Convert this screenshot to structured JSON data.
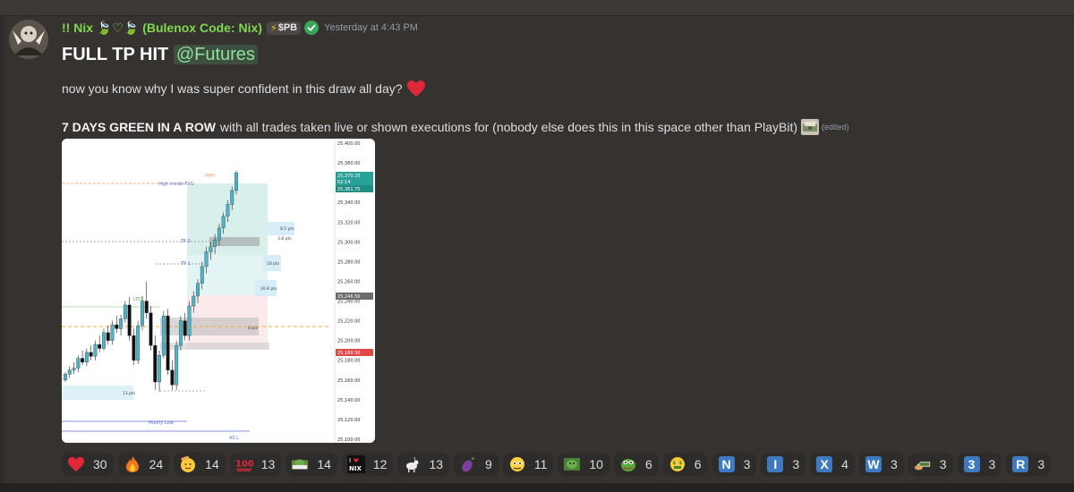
{
  "message": {
    "username": "!! Nix 🍃♡🍃 (Bulenox Code: Nix)",
    "tag": "$PB",
    "timestamp": "Yesterday at 4:43 PM",
    "title": "FULL TP HIT",
    "mention": "@Futures",
    "line2": "now you know why I was super confident in this draw all day?",
    "line3_bold": "7 DAYS GREEN IN A ROW",
    "line3_rest": "with all trades taken live or shown executions for (nobody else does this in this space other than PlayBit)",
    "edited": "(edited)"
  },
  "chart_labels": {
    "pmh": "PMH",
    "high_inside_fvg": "High Inside FVG",
    "tp2": "TP 2",
    "tp1": "TP 1",
    "ltcs": "LTCS",
    "hourly_low": "Hourly Low",
    "asl": "AS.L",
    "pts_8_5": "8.5 pts",
    "pts_3_8": "3.8 pts",
    "pts_18": "18 pts",
    "pts_16_8": "16.8 pts",
    "pts_8": "8 pts",
    "pts_13": "13 pts",
    "price_badge_1": "25,370.25",
    "price_badge_2": "02:14",
    "price_badge_3": "25,361.75",
    "price_badge_4": "25,246.50",
    "price_badge_5": "25,189.50"
  },
  "chart_data": {
    "type": "candlestick",
    "y_ticks": [
      "25,400.00",
      "25,380.00",
      "25,360.00",
      "25,340.00",
      "25,320.00",
      "25,300.00",
      "25,280.00",
      "25,260.00",
      "25,240.00",
      "25,220.00",
      "25,200.00",
      "25,180.00",
      "25,160.00",
      "25,140.00",
      "25,120.00",
      "25,100.00"
    ],
    "ylim": [
      25100,
      25400
    ],
    "candles": [
      [
        25160,
        25168,
        25158,
        25166
      ],
      [
        25166,
        25174,
        25162,
        25170
      ],
      [
        25170,
        25178,
        25166,
        25172
      ],
      [
        25172,
        25185,
        25168,
        25182
      ],
      [
        25182,
        25190,
        25175,
        25178
      ],
      [
        25178,
        25192,
        25174,
        25188
      ],
      [
        25188,
        25195,
        25180,
        25184
      ],
      [
        25184,
        25200,
        25180,
        25196
      ],
      [
        25196,
        25205,
        25188,
        25192
      ],
      [
        25192,
        25212,
        25190,
        25208
      ],
      [
        25208,
        25215,
        25196,
        25200
      ],
      [
        25200,
        25220,
        25196,
        25216
      ],
      [
        25216,
        25225,
        25208,
        25212
      ],
      [
        25212,
        25226,
        25205,
        25222
      ],
      [
        25222,
        25240,
        25218,
        25236
      ],
      [
        25236,
        25244,
        25200,
        25205
      ],
      [
        25205,
        25212,
        25175,
        25180
      ],
      [
        25180,
        25220,
        25176,
        25215
      ],
      [
        25215,
        25245,
        25210,
        25240
      ],
      [
        25240,
        25260,
        25222,
        25228
      ],
      [
        25228,
        25235,
        25190,
        25195
      ],
      [
        25195,
        25205,
        25150,
        25158
      ],
      [
        25158,
        25190,
        25148,
        25185
      ],
      [
        25185,
        25230,
        25182,
        25225
      ],
      [
        25225,
        25232,
        25165,
        25170
      ],
      [
        25170,
        25180,
        25150,
        25155
      ],
      [
        25155,
        25200,
        25150,
        25195
      ],
      [
        25195,
        25225,
        25190,
        25220
      ],
      [
        25220,
        25228,
        25200,
        25205
      ],
      [
        25205,
        25240,
        25200,
        25235
      ],
      [
        25235,
        25250,
        25228,
        25245
      ],
      [
        25245,
        25262,
        25238,
        25258
      ],
      [
        25258,
        25280,
        25252,
        25275
      ],
      [
        25275,
        25295,
        25268,
        25290
      ],
      [
        25290,
        25300,
        25282,
        25295
      ],
      [
        25295,
        25308,
        25288,
        25302
      ],
      [
        25302,
        25318,
        25296,
        25314
      ],
      [
        25314,
        25330,
        25308,
        25326
      ],
      [
        25326,
        25342,
        25320,
        25338
      ],
      [
        25338,
        25356,
        25332,
        25352
      ],
      [
        25352,
        25372,
        25348,
        25370
      ]
    ]
  },
  "reactions": [
    {
      "emoji": "heart",
      "count": "30"
    },
    {
      "emoji": "fire",
      "count": "24"
    },
    {
      "emoji": "saluting-face",
      "count": "14"
    },
    {
      "emoji": "hundred",
      "count": "13"
    },
    {
      "emoji": "money-pepe",
      "count": "14"
    },
    {
      "emoji": "i-heart-nix",
      "count": "12"
    },
    {
      "emoji": "goat",
      "count": "13"
    },
    {
      "emoji": "eggplant",
      "count": "9"
    },
    {
      "emoji": "pepe-face",
      "count": "11"
    },
    {
      "emoji": "pepe-money",
      "count": "10"
    },
    {
      "emoji": "pepe-green",
      "count": "6"
    },
    {
      "emoji": "money-mouth",
      "count": "6"
    },
    {
      "letter": "N",
      "count": "3"
    },
    {
      "letter": "I",
      "count": "3"
    },
    {
      "letter": "X",
      "count": "4"
    },
    {
      "letter": "W",
      "count": "3"
    },
    {
      "emoji": "cash-hand",
      "count": "3"
    },
    {
      "letter": "3",
      "count": "3"
    },
    {
      "letter": "R",
      "count": "3"
    }
  ],
  "colors": {
    "username": "#7fd84f",
    "mention_bg": "#3e4e3f",
    "mention_fg": "#8ee39a",
    "background": "#353230",
    "reaction_bg": "#2e2c2a",
    "letter_tile": "#3e7ac2",
    "heart": "#e0283b"
  }
}
